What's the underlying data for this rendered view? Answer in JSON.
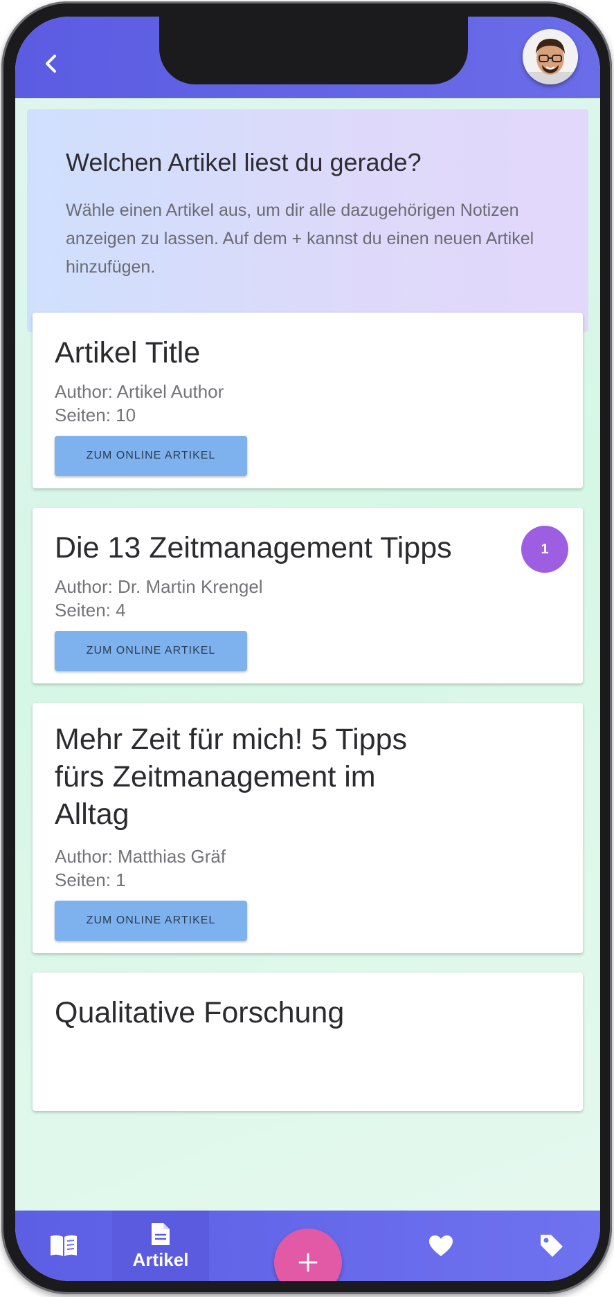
{
  "info": {
    "title": "Welchen Artikel liest du gerade?",
    "text": "Wähle einen Artikel aus, um dir alle dazugehörigen Notizen anzeigen zu lassen. Auf dem + kannst du einen neuen Artikel hinzufügen."
  },
  "articles": [
    {
      "title": "Artikel Title",
      "author": "Author: Artikel Author",
      "pages": "Seiten: 10",
      "button": "ZUM ONLINE ARTIKEL"
    },
    {
      "title": "Die 13 Zeitmanagement Tipps",
      "author": "Author: Dr. Martin Krengel",
      "pages": "Seiten: 4",
      "button": "ZUM ONLINE ARTIKEL",
      "badge": "1"
    },
    {
      "title": "Mehr Zeit für mich! 5 Tipps fürs Zeitmanagement im Alltag",
      "author": "Author: Matthias Gräf",
      "pages": "Seiten: 1",
      "button": "ZUM ONLINE ARTIKEL"
    },
    {
      "title": "Qualitative Forschung"
    }
  ],
  "nav": {
    "items": [
      {
        "icon": "book-icon"
      },
      {
        "icon": "document-icon",
        "label": "Artikel",
        "active": true
      },
      {
        "icon": "heart-icon"
      },
      {
        "icon": "tag-icon"
      }
    ],
    "fab_icon": "plus-icon"
  },
  "colors": {
    "header": "#5b5ce2",
    "badge": "#9e5ee2",
    "fab": "#e25aa6",
    "button": "#7eb2ee"
  }
}
